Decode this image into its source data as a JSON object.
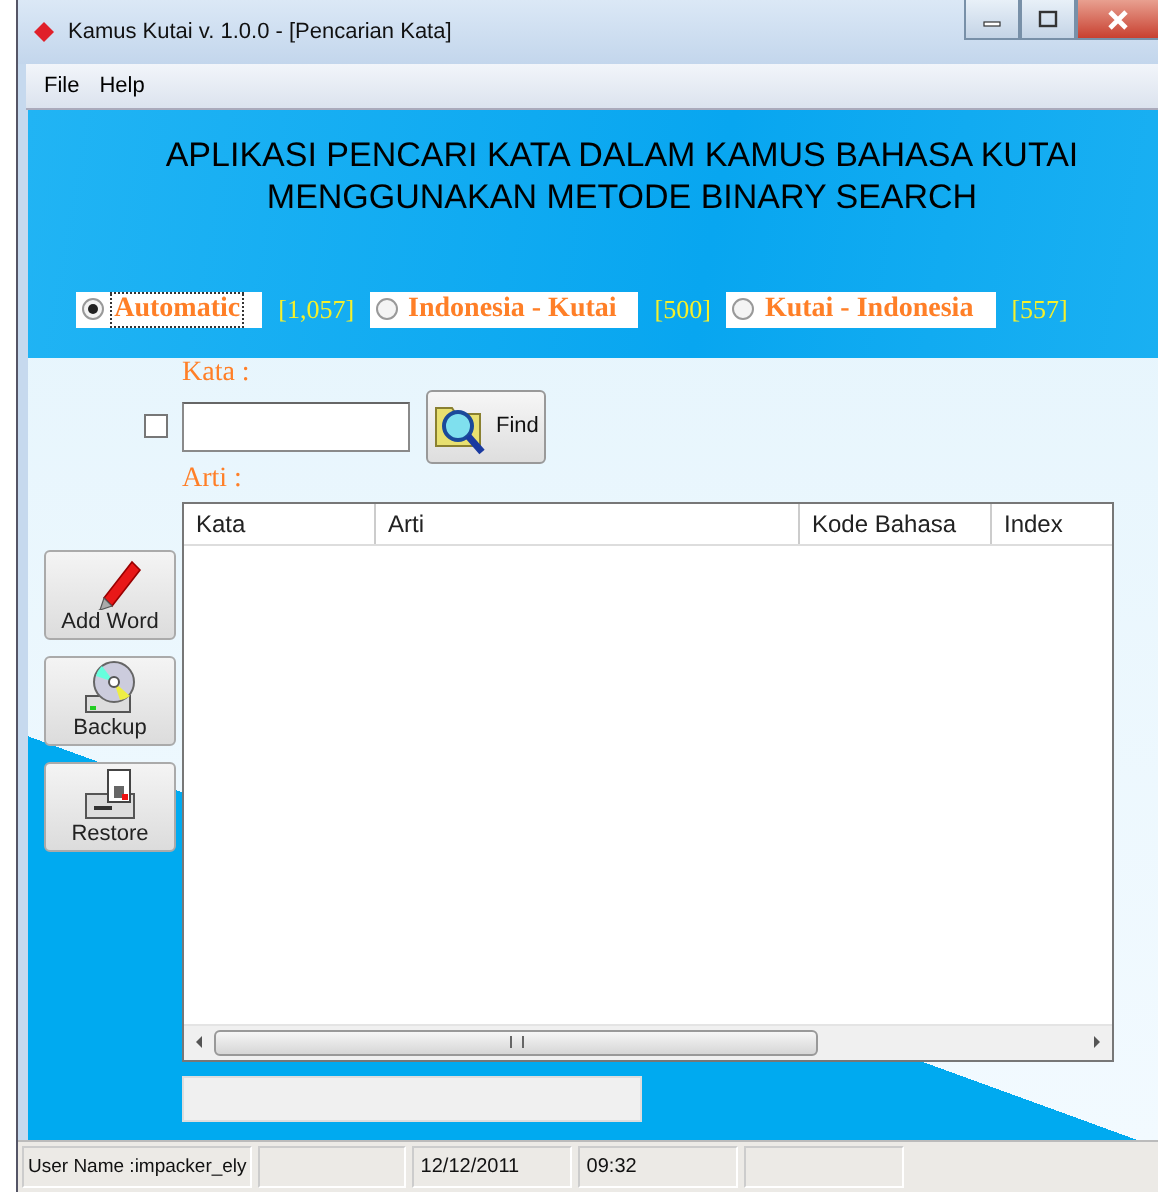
{
  "window": {
    "title": "Kamus Kutai v. 1.0.0 - [Pencarian Kata]"
  },
  "menu": [
    "File",
    "Help"
  ],
  "heading": [
    "APLIKASI PENCARI KATA DALAM KAMUS BAHASA KUTAI",
    "MENGGUNAKAN METODE BINARY SEARCH"
  ],
  "modes": [
    {
      "label": "Automatic",
      "selected": true,
      "count": "[1,057]"
    },
    {
      "label": "Indonesia - Kutai",
      "selected": false,
      "count": "[500]"
    },
    {
      "label": "Kutai - Indonesia",
      "selected": false,
      "count": "[557]"
    }
  ],
  "search": {
    "label": "Kata :",
    "checked": false,
    "button": "Find"
  },
  "result": {
    "label": "Arti :",
    "columns": [
      "Kata",
      "Arti",
      "Kode Bahasa",
      "Index"
    ]
  },
  "sidebar": [
    {
      "kind": "add",
      "label": "Add Word"
    },
    {
      "kind": "backup",
      "label": "Backup"
    },
    {
      "kind": "restore",
      "label": "Restore"
    }
  ],
  "status_bar": {
    "user": "User Name :impacker_ely",
    "date": "12/12/2011",
    "time": "09:32"
  }
}
